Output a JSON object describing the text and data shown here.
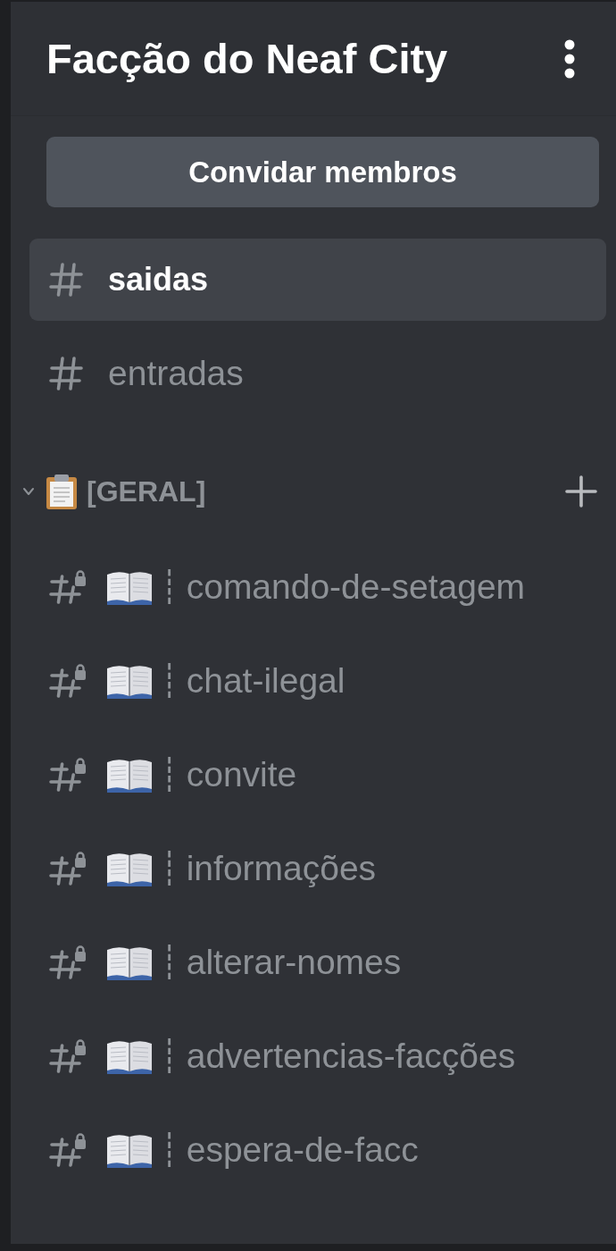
{
  "server": {
    "name": "Facção do Neaf City"
  },
  "invite_button": {
    "label": "Convidar membros"
  },
  "channels": [
    {
      "kind": "plain",
      "name": "saidas",
      "selected": true,
      "locked": false
    },
    {
      "kind": "plain",
      "name": "entradas",
      "selected": false,
      "locked": false
    }
  ],
  "categories": [
    {
      "name": "[GERAL]",
      "expanded": true,
      "channels": [
        {
          "kind": "decorated",
          "separator": "┊",
          "name": "comando-de-setagem",
          "selected": false,
          "locked": true
        },
        {
          "kind": "decorated",
          "separator": "┊",
          "name": "chat-ilegal",
          "selected": false,
          "locked": true
        },
        {
          "kind": "decorated",
          "separator": "┊",
          "name": "convite",
          "selected": false,
          "locked": true
        },
        {
          "kind": "decorated",
          "separator": "┊",
          "name": "informações",
          "selected": false,
          "locked": true
        },
        {
          "kind": "decorated",
          "separator": "┊",
          "name": "alterar-nomes",
          "selected": false,
          "locked": true
        },
        {
          "kind": "decorated",
          "separator": "┊",
          "name": "advertencias-facções",
          "selected": false,
          "locked": true
        },
        {
          "kind": "decorated",
          "separator": "┊",
          "name": "espera-de-facc",
          "selected": false,
          "locked": true
        }
      ]
    }
  ]
}
